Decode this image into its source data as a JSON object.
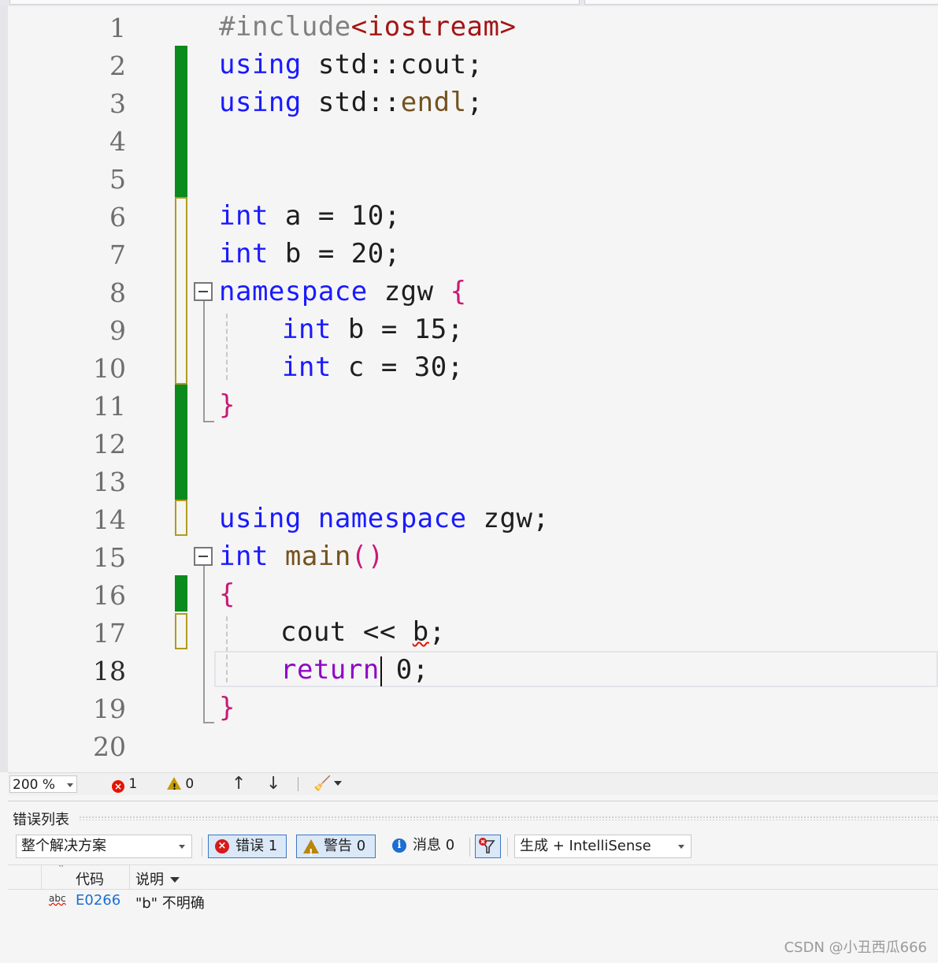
{
  "editor": {
    "line_numbers": [
      "1",
      "2",
      "3",
      "4",
      "5",
      "6",
      "7",
      "8",
      "9",
      "10",
      "11",
      "12",
      "13",
      "14",
      "15",
      "16",
      "17",
      "18",
      "19",
      "20"
    ],
    "current_line": "18",
    "code": {
      "l1_directive": "#include",
      "l1_header": "<iostream>",
      "l2_using": "using",
      "l2_rest": " std::cout;",
      "l3_using": "using",
      "l3_std": " std::",
      "l3_endl": "endl",
      "l3_semi": ";",
      "l6_type": "int",
      "l6_rest": " a = 10;",
      "l7_type": "int",
      "l7_rest": " b = 20;",
      "l8_ns": "namespace",
      "l8_name": " zgw ",
      "l8_brace": "{",
      "l9_type": "int",
      "l9_rest": " b = 15;",
      "l10_type": "int",
      "l10_rest": " c = 30;",
      "l11_brace": "}",
      "l14_using": "using",
      "l14_ns": "namespace",
      "l14_rest": " zgw;",
      "l15_type": "int",
      "l15_fn": "main",
      "l15_parens": "()",
      "l16_brace": "{",
      "l17_cout": "cout << ",
      "l17_b": "b",
      "l17_semi": ";",
      "l18_return": "return",
      "l18_rest": " 0;",
      "l19_brace": "}"
    }
  },
  "status_bar": {
    "zoom": "200 %",
    "error_count": "1",
    "warning_count": "0",
    "up_arrow": "↑",
    "down_arrow": "↓",
    "brush_icon": "🧹"
  },
  "error_list": {
    "title": "错误列表",
    "scope": "整个解决方案",
    "errors_label": "错误 1",
    "warnings_label": "警告 0",
    "messages_label": "消息 0",
    "build_filter": "生成 + IntelliSense",
    "columns": {
      "code": "代码",
      "description": "说明"
    },
    "rows": [
      {
        "icon": "abc",
        "code": "E0266",
        "description": "\"b\" 不明确"
      }
    ]
  },
  "watermark": "CSDN @小丑西瓜666",
  "colors": {
    "keyword": "#1a1aff",
    "brace": "#c81a78",
    "saved_change": "#0b8a1e",
    "unsaved_change": "#b39b1c",
    "error": "#e51400"
  }
}
